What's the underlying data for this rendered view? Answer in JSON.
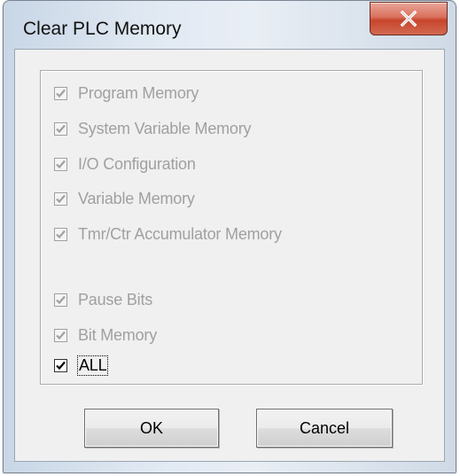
{
  "dialog": {
    "title": "Clear PLC Memory",
    "close_icon": "close-x-icon"
  },
  "options": [
    {
      "label": "Program Memory",
      "checked": true,
      "enabled": false
    },
    {
      "label": "System Variable Memory",
      "checked": true,
      "enabled": false
    },
    {
      "label": "I/O Configuration",
      "checked": true,
      "enabled": false
    },
    {
      "label": "Variable Memory",
      "checked": true,
      "enabled": false
    },
    {
      "label": "Tmr/Ctr Accumulator Memory",
      "checked": true,
      "enabled": false
    },
    {
      "label": "Pause Bits",
      "checked": true,
      "enabled": false
    },
    {
      "label": "Bit Memory",
      "checked": true,
      "enabled": false
    },
    {
      "label": "ALL",
      "checked": true,
      "enabled": true
    }
  ],
  "buttons": {
    "ok_label": "OK",
    "cancel_label": "Cancel"
  },
  "colors": {
    "disabled_text": "#a0a0a0",
    "close_button": "#c7442c"
  }
}
